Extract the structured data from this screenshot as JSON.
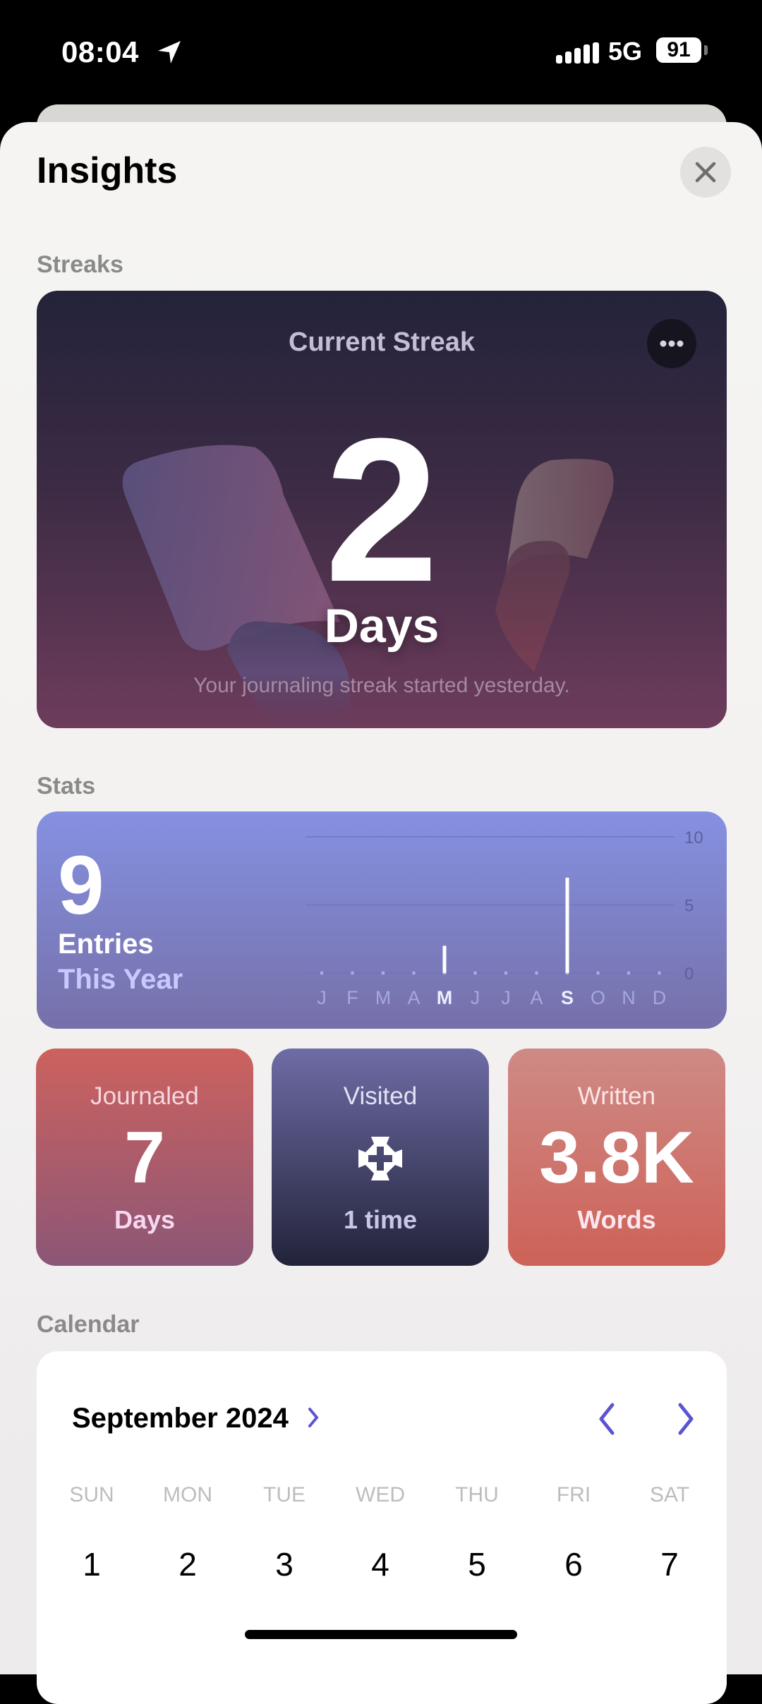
{
  "status_bar": {
    "time": "08:04",
    "network": "5G",
    "battery": "91"
  },
  "header": {
    "title": "Insights",
    "close_icon": "close-icon"
  },
  "sections": {
    "streaks": "Streaks",
    "stats": "Stats",
    "calendar": "Calendar"
  },
  "streak": {
    "title": "Current Streak",
    "value": "2",
    "unit": "Days",
    "subtitle": "Your journaling streak started yesterday."
  },
  "stats": {
    "entries": "9",
    "entries_label": "Entries",
    "entries_period": "This Year",
    "chart_data": {
      "type": "bar",
      "categories": [
        "J",
        "F",
        "M",
        "A",
        "M",
        "J",
        "J",
        "A",
        "S",
        "O",
        "N",
        "D"
      ],
      "values": [
        0,
        0,
        0,
        0,
        2,
        0,
        0,
        0,
        7,
        0,
        0,
        0
      ],
      "yticks": [
        "10",
        "5",
        "0"
      ],
      "ylim": [
        0,
        10
      ],
      "highlighted": [
        4,
        8
      ]
    }
  },
  "tiles": [
    {
      "label": "Journaled",
      "value": "7",
      "unit": "Days"
    },
    {
      "label": "Visited",
      "icon": "places-icon",
      "unit": "1 time"
    },
    {
      "label": "Written",
      "value": "3.8K",
      "unit": "Words"
    }
  ],
  "calendar": {
    "month": "September 2024",
    "weekdays": [
      "SUN",
      "MON",
      "TUE",
      "WED",
      "THU",
      "FRI",
      "SAT"
    ],
    "days": [
      "1",
      "2",
      "3",
      "4",
      "5",
      "6",
      "7"
    ],
    "accent": "#5a55d0"
  }
}
